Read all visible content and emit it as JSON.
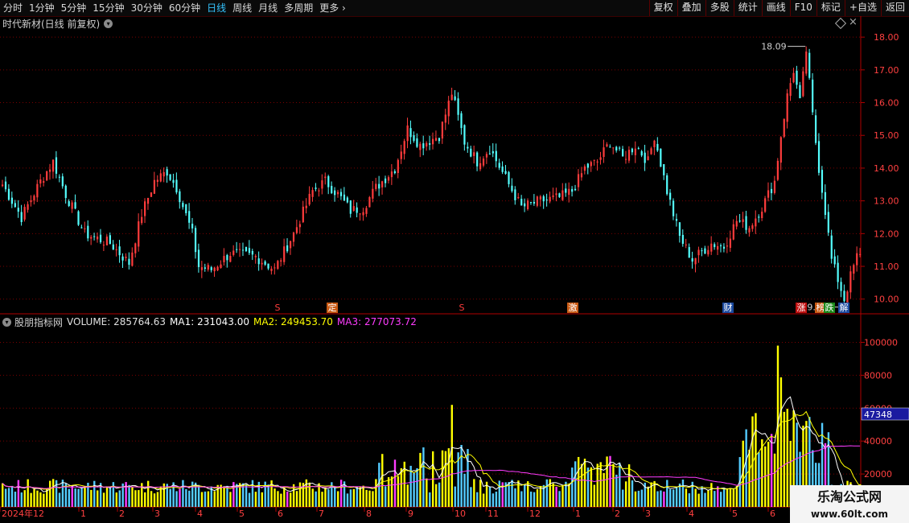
{
  "toolbar": {
    "periods": [
      {
        "label": "分时",
        "active": false
      },
      {
        "label": "1分钟",
        "active": false
      },
      {
        "label": "5分钟",
        "active": false
      },
      {
        "label": "15分钟",
        "active": false
      },
      {
        "label": "30分钟",
        "active": false
      },
      {
        "label": "60分钟",
        "active": false
      },
      {
        "label": "日线",
        "active": true
      },
      {
        "label": "周线",
        "active": false
      },
      {
        "label": "月线",
        "active": false
      },
      {
        "label": "多周期",
        "active": false
      },
      {
        "label": "更多",
        "active": false
      }
    ],
    "tools": [
      "复权",
      "叠加",
      "多股",
      "统计",
      "画线",
      "F10",
      "标记",
      "+自选",
      "返回"
    ]
  },
  "stock": {
    "title": "时代新材(日线 前复权)"
  },
  "indicator": {
    "name": "股朋指标网",
    "volume": "VOLUME: 285764.63",
    "ma1": "MA1: 231043.00",
    "ma2": "MA2: 249453.70",
    "ma3": "MA3: 277073.72"
  },
  "colors": {
    "up": "#ff3c3c",
    "down": "#54ffff",
    "ma1": "#ffffff",
    "ma2": "#ffff00",
    "ma3": "#ff3cff",
    "axis": "#b00000",
    "volume_bar": "#ffff00"
  },
  "watermark": {
    "name": "乐淘公式网",
    "url": "www.60lt.com"
  },
  "chart_data": [
    {
      "type": "candlestick",
      "y_ticks": [
        10.0,
        11.0,
        12.0,
        13.0,
        14.0,
        15.0,
        16.0,
        17.0,
        18.0
      ],
      "ylim": [
        9.6,
        18.2
      ],
      "high_label": "18.09",
      "low_label": "9.86",
      "anchors": [
        [
          0,
          13.5
        ],
        [
          6,
          12.5
        ],
        [
          12,
          13.6
        ],
        [
          16,
          14.2
        ],
        [
          20,
          13.2
        ],
        [
          26,
          12.0
        ],
        [
          34,
          11.7
        ],
        [
          40,
          11.1
        ],
        [
          44,
          12.6
        ],
        [
          48,
          13.6
        ],
        [
          52,
          13.9
        ],
        [
          55,
          13.4
        ],
        [
          60,
          12.0
        ],
        [
          62,
          11.0
        ],
        [
          66,
          10.9
        ],
        [
          72,
          11.4
        ],
        [
          80,
          11.3
        ],
        [
          86,
          10.9
        ],
        [
          92,
          12.0
        ],
        [
          98,
          13.3
        ],
        [
          102,
          13.6
        ],
        [
          106,
          13.2
        ],
        [
          110,
          12.7
        ],
        [
          114,
          12.8
        ],
        [
          118,
          13.4
        ],
        [
          124,
          14.0
        ],
        [
          128,
          15.2
        ],
        [
          132,
          14.7
        ],
        [
          138,
          15.0
        ],
        [
          142,
          16.3
        ],
        [
          146,
          14.8
        ],
        [
          150,
          14.2
        ],
        [
          154,
          14.6
        ],
        [
          160,
          13.5
        ],
        [
          164,
          12.8
        ],
        [
          170,
          13.0
        ],
        [
          176,
          13.1
        ],
        [
          180,
          13.3
        ],
        [
          184,
          14.0
        ],
        [
          188,
          14.2
        ],
        [
          192,
          14.8
        ],
        [
          196,
          14.3
        ],
        [
          200,
          14.7
        ],
        [
          204,
          14.2
        ],
        [
          206,
          15.0
        ],
        [
          210,
          13.3
        ],
        [
          214,
          11.9
        ],
        [
          218,
          11.2
        ],
        [
          224,
          11.7
        ],
        [
          228,
          11.6
        ],
        [
          232,
          12.4
        ],
        [
          236,
          12.2
        ],
        [
          240,
          12.8
        ],
        [
          244,
          13.6
        ],
        [
          246,
          15.0
        ],
        [
          248,
          16.2
        ],
        [
          250,
          17.0
        ],
        [
          252,
          16.0
        ],
        [
          254,
          17.6
        ],
        [
          256,
          15.6
        ],
        [
          258,
          14.0
        ],
        [
          260,
          12.7
        ],
        [
          262,
          11.2
        ],
        [
          264,
          10.6
        ],
        [
          266,
          10.0
        ],
        [
          268,
          10.7
        ],
        [
          270,
          11.3
        ]
      ],
      "signals": [
        {
          "label": "S",
          "color": "#ff3c3c",
          "bg": ""
        },
        {
          "label": "定",
          "color": "#ffffff",
          "bg": "#c85a14"
        },
        {
          "label": "S",
          "color": "#ff3c3c",
          "bg": ""
        },
        {
          "label": "激",
          "color": "#ffffff",
          "bg": "#c85a14"
        },
        {
          "label": "财",
          "color": "#ffffff",
          "bg": "#1a4aa0"
        },
        {
          "label": "涨",
          "color": "#ffffff",
          "bg": "#c01010"
        },
        {
          "label": "榜",
          "color": "#ffffff",
          "bg": "#c85a14"
        },
        {
          "label": "跌",
          "color": "#ffffff",
          "bg": "#1a8a1a"
        },
        {
          "label": "解",
          "color": "#ffffff",
          "bg": "#1a4aa0"
        }
      ]
    },
    {
      "type": "bar",
      "title": "VOLUME",
      "y_ticks": [
        20000,
        40000,
        60000,
        80000,
        100000
      ],
      "ylim": [
        0,
        110000
      ],
      "current_value_label": "47348",
      "x_labels": [
        "2024年12",
        "1",
        "2",
        "3",
        "4",
        "5",
        "6",
        "7",
        "8",
        "9",
        "10",
        "11",
        "12",
        "1",
        "2",
        "3",
        "4",
        "5",
        "6"
      ]
    }
  ]
}
